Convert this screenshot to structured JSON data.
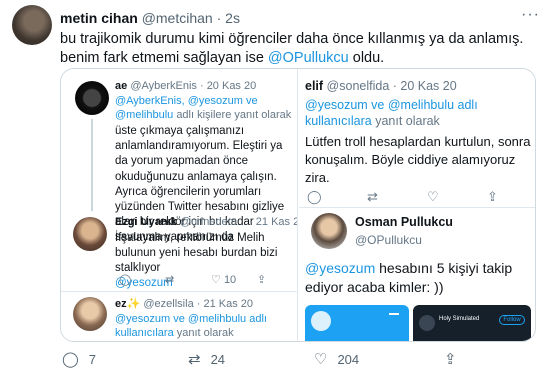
{
  "tweet": {
    "author_name": "metin cihan",
    "author_handle": "@metcihan",
    "separator": "·",
    "time": "2s",
    "more": "···",
    "text_1": "bu trajikomik durumu kimi öğrenciler daha önce kıllanmış ya da anlamış. benim fark etmemi sağlayan ise ",
    "mention": "@OPullukcu",
    "text_2": " oldu."
  },
  "left_shot": {
    "t1": {
      "avatar_text": "ae",
      "name": "ae",
      "handle": "@AyberkEnis · 20 Kas 20",
      "reply_mentions": "@AyberkEnis, @yesozum ve @melihbulu",
      "reply_suffix": "adlı kişilere yanıt olarak",
      "text": "üste çıkmaya çalışmanızı anlamlandıramıyorum. Eleştiri ya da yorum yapmadan önce okuduğunuzu anlamaya çalışın. Ayrıca öğrencilerin yorumları yüzünden Twitter hesabını gizliye alan bir rektör için bu kadar savunma yapmanızı da"
    },
    "t2": {
      "name": "Ezgi Uyanık",
      "handle": "@urlnedem... · 21 Kas 20",
      "text": "İfşalayalım, rektörümüz Melih bulunun yeni hesabı burdan bizi stalklıyor",
      "mention": "@yesozum",
      "like_count": "10"
    },
    "t3": {
      "name": "ez✨",
      "handle": "@ezellsila · 21 Kas 20",
      "reply_mentions": "@yesozum ve @melihbulu adlı kullanıcılara",
      "reply_suffix": "yanıt olarak"
    }
  },
  "right_shot": {
    "t1": {
      "name": "elif",
      "handle": "@sonelfida · 20 Kas 20",
      "reply_mentions": "@yesozum ve @melihbulu adlı kullanıcılara",
      "reply_suffix": "yanıt olarak",
      "text": "Lütfen troll hesaplardan kurtulun, sonra konuşalım. Böyle ciddiye alamıyoruz zira."
    },
    "t2": {
      "name": "Osman Pullukcu",
      "handle": "@OPullukcu",
      "mention": "@yesozum",
      "text": " hesabını 5 kişiyi takip ediyor acaba kimler: ))",
      "profile_card": {
        "name": "Holy Simulated",
        "button": "Follow"
      }
    }
  },
  "actions": {
    "reply_count": "7",
    "retweet_count": "24",
    "like_count": "204",
    "reply_icon": "reply-icon",
    "retweet_icon": "retweet-icon",
    "like_icon": "heart-icon",
    "share_icon": "share-icon"
  }
}
